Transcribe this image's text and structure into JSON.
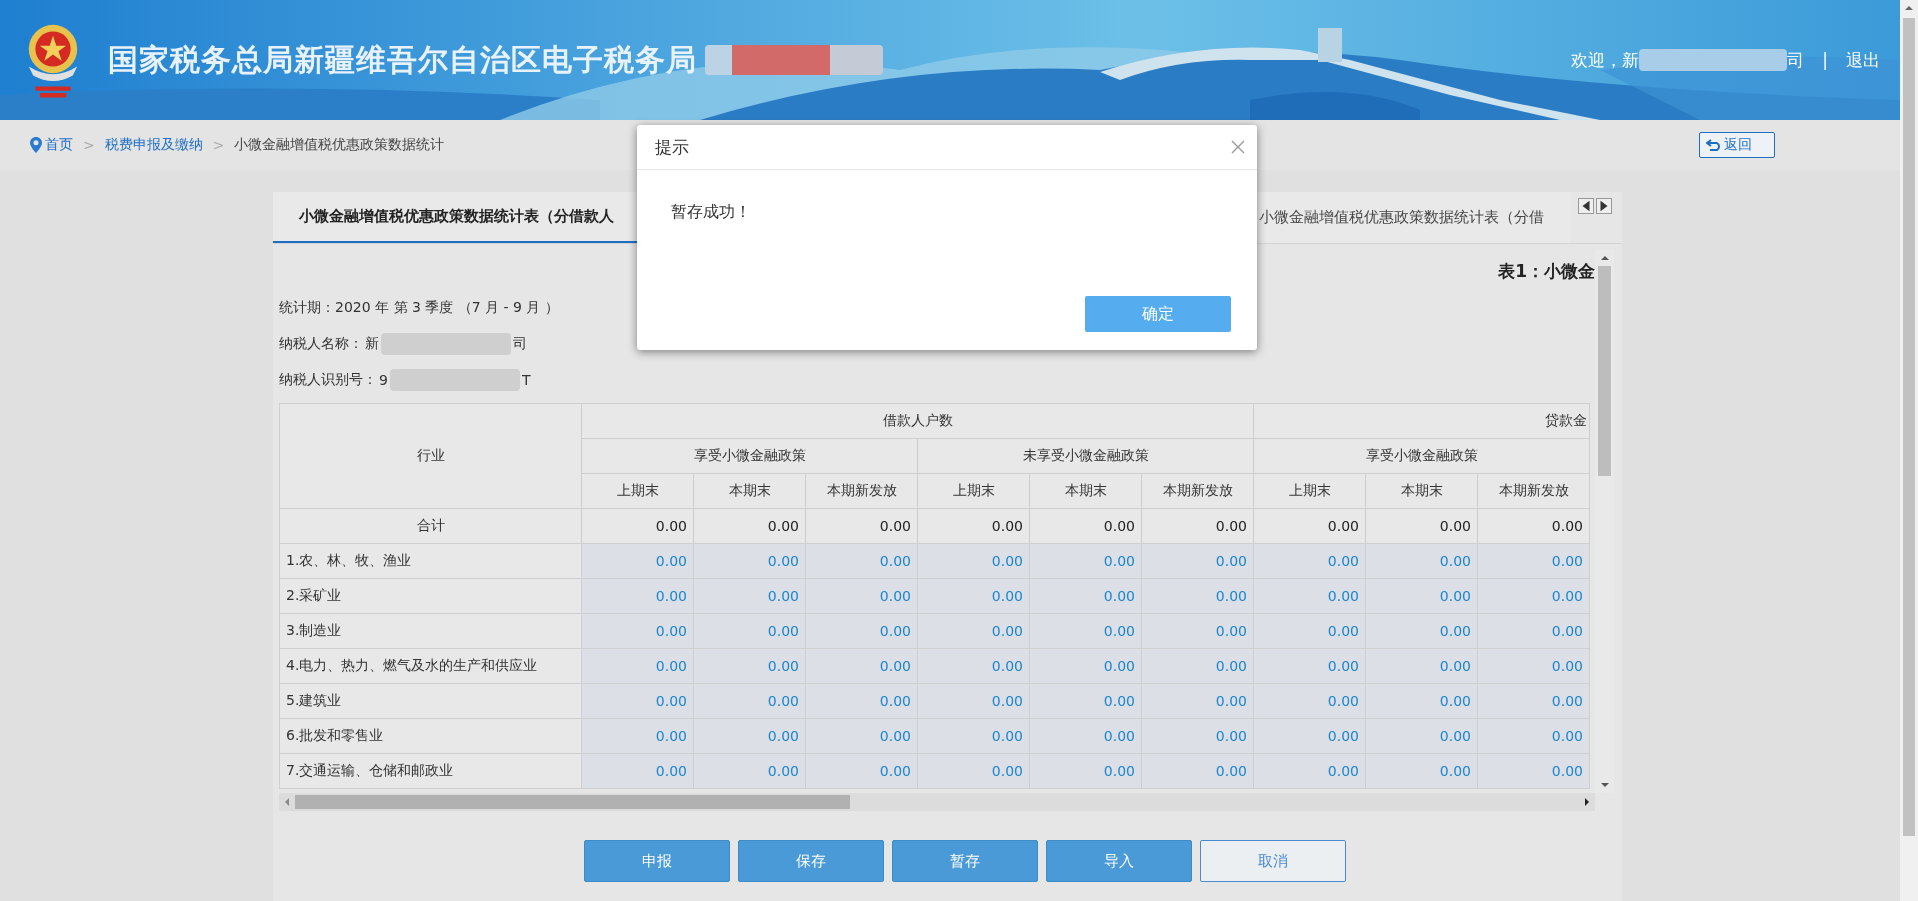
{
  "header": {
    "title": "国家税务总局新疆维吾尔自治区电子税务局",
    "welcome": "欢迎，新",
    "welcome_end": "司",
    "logout": "退出",
    "separator": "|"
  },
  "breadcrumb": {
    "items": [
      "首页",
      "税费申报及缴纳"
    ],
    "current": "小微金融增值税优惠政策数据统计",
    "separator": ">",
    "back": "返回"
  },
  "tabs": [
    {
      "label": "小微金融增值税优惠政策数据统计表（分借款人",
      "selected": true
    },
    {
      "label": "小微金融增值税优惠政策数据统计表（分借",
      "selected": false
    }
  ],
  "form": {
    "table_title": "表1：小微金",
    "period": "统计期：2020 年 第 3 季度 （7 月 - 9 月 ）",
    "name_label": "纳税人名称：",
    "name_start": "新",
    "name_end": "司",
    "id_label": "纳税人识别号：",
    "id_start": "9",
    "id_end": "T"
  },
  "table": {
    "first_header": "行业",
    "groups": [
      {
        "label": "借款人户数",
        "subgroups": [
          "享受小微金融政策",
          "未享受小微金融政策"
        ]
      },
      {
        "label": "贷款金",
        "subgroups": [
          "享受小微金融政策"
        ]
      }
    ],
    "columns": [
      "上期末",
      "本期末",
      "本期新发放",
      "上期末",
      "本期末",
      "本期新发放",
      "上期末",
      "本期末",
      "本期新发放"
    ],
    "rows": [
      {
        "kind": "total",
        "label": "合计",
        "values": [
          "0.00",
          "0.00",
          "0.00",
          "0.00",
          "0.00",
          "0.00",
          "0.00",
          "0.00",
          "0.00"
        ]
      },
      {
        "kind": "input",
        "label": "1.农、林、牧、渔业",
        "values": [
          "0.00",
          "0.00",
          "0.00",
          "0.00",
          "0.00",
          "0.00",
          "0.00",
          "0.00",
          "0.00"
        ]
      },
      {
        "kind": "input",
        "label": "2.采矿业",
        "values": [
          "0.00",
          "0.00",
          "0.00",
          "0.00",
          "0.00",
          "0.00",
          "0.00",
          "0.00",
          "0.00"
        ]
      },
      {
        "kind": "input",
        "label": "3.制造业",
        "values": [
          "0.00",
          "0.00",
          "0.00",
          "0.00",
          "0.00",
          "0.00",
          "0.00",
          "0.00",
          "0.00"
        ]
      },
      {
        "kind": "input",
        "label": "4.电力、热力、燃气及水的生产和供应业",
        "values": [
          "0.00",
          "0.00",
          "0.00",
          "0.00",
          "0.00",
          "0.00",
          "0.00",
          "0.00",
          "0.00"
        ]
      },
      {
        "kind": "input",
        "label": "5.建筑业",
        "values": [
          "0.00",
          "0.00",
          "0.00",
          "0.00",
          "0.00",
          "0.00",
          "0.00",
          "0.00",
          "0.00"
        ]
      },
      {
        "kind": "input",
        "label": "6.批发和零售业",
        "values": [
          "0.00",
          "0.00",
          "0.00",
          "0.00",
          "0.00",
          "0.00",
          "0.00",
          "0.00",
          "0.00"
        ]
      },
      {
        "kind": "input",
        "label": "7.交通运输、仓储和邮政业",
        "values": [
          "0.00",
          "0.00",
          "0.00",
          "0.00",
          "0.00",
          "0.00",
          "0.00",
          "0.00",
          "0.00"
        ]
      }
    ]
  },
  "buttons": [
    {
      "label": "申报",
      "kind": "primary"
    },
    {
      "label": "保存",
      "kind": "primary"
    },
    {
      "label": "暂存",
      "kind": "primary"
    },
    {
      "label": "导入",
      "kind": "primary"
    },
    {
      "label": "取消",
      "kind": "outline"
    }
  ],
  "dialog": {
    "title": "提示",
    "message": "暂存成功！",
    "ok": "确定"
  }
}
